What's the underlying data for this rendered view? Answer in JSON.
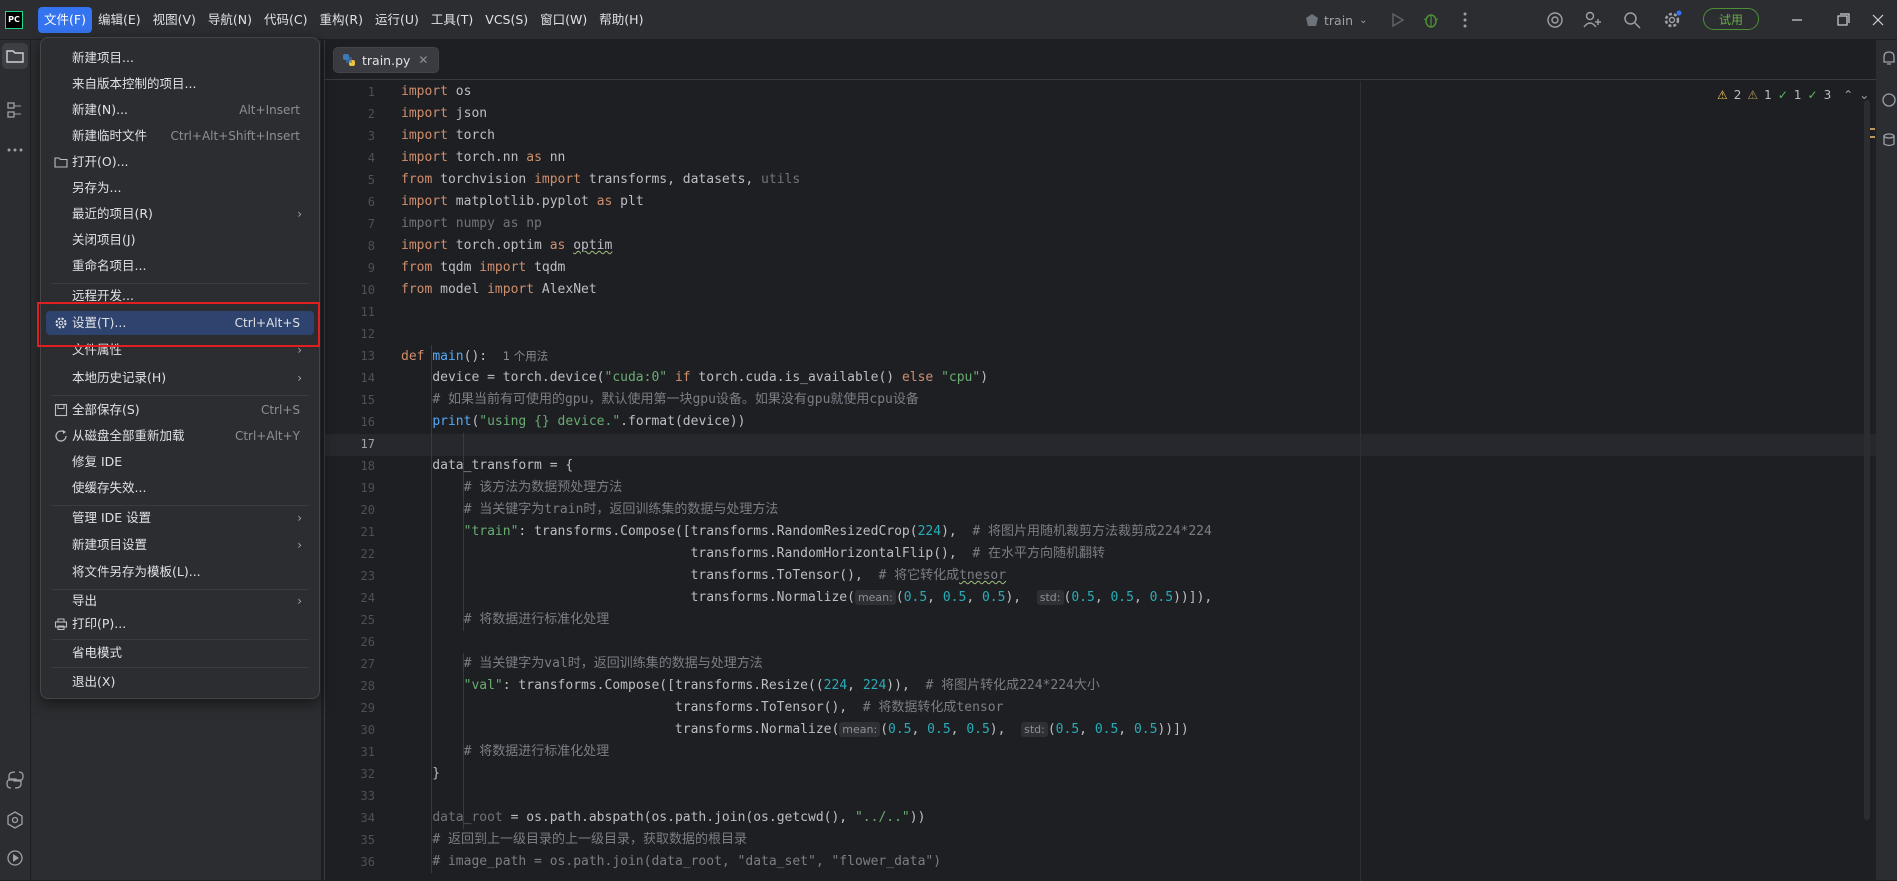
{
  "menubar": {
    "items": [
      "文件(F)",
      "编辑(E)",
      "视图(V)",
      "导航(N)",
      "代码(C)",
      "重构(R)",
      "运行(U)",
      "工具(T)",
      "VCS(S)",
      "窗口(W)",
      "帮助(H)"
    ]
  },
  "toolbar": {
    "run_config": "train",
    "trial_label": "试用"
  },
  "editor": {
    "tab_label": "train.py",
    "inspections": {
      "warnings": "2",
      "weak_warnings": "1",
      "typos": "1",
      "ok": "3"
    },
    "usage_hint": "1 个用法",
    "param_hints": {
      "mean": "mean:",
      "std": "std:"
    },
    "line_numbers": [
      "1",
      "2",
      "3",
      "4",
      "5",
      "6",
      "7",
      "8",
      "9",
      "10",
      "11",
      "12",
      "13",
      "14",
      "15",
      "16",
      "17",
      "18",
      "19",
      "20",
      "21",
      "22",
      "23",
      "24",
      "25",
      "26",
      "27",
      "28",
      "29",
      "30",
      "31",
      "32",
      "33",
      "34",
      "35",
      "36"
    ],
    "code": {
      "c14": "# 如果当前有可使用的gpu，默认使用第一块gpu设备。如果没有gpu就使用cpu设备",
      "c19": "# 该方法为数据预处理方法",
      "c20": "# 当关键字为train时，返回训练集的数据与处理方法",
      "c21": "# 将图片用随机裁剪方法裁剪成224*224",
      "c22": "# 在水平方向随机翻转",
      "c23a": "# 将它转化成",
      "c23b": "tnesor",
      "c25": "# 将数据进行标准化处理",
      "c27": "# 当关键字为val时，返回训练集的数据与处理方法",
      "c28": "# 将图片转化成224*224大小",
      "c29": "# 将数据转化成tensor",
      "c31": "# 将数据进行标准化处理",
      "c35": "# 返回到上一级目录的上一级目录，获取数据的根目录",
      "c36": "# image_path = os.path.join(data_root, \"data_set\", \"flower_data\")"
    }
  },
  "file_menu": {
    "items": [
      {
        "label": "新建项目...",
        "shortcut": ""
      },
      {
        "label": "来自版本控制的项目...",
        "shortcut": ""
      },
      {
        "label": "新建(N)...",
        "shortcut": "Alt+Insert"
      },
      {
        "label": "新建临时文件",
        "shortcut": "Ctrl+Alt+Shift+Insert"
      },
      {
        "label": "打开(O)...",
        "shortcut": ""
      },
      {
        "label": "另存为...",
        "shortcut": ""
      },
      {
        "label": "最近的项目(R)",
        "shortcut": ""
      },
      {
        "label": "关闭项目(J)",
        "shortcut": ""
      },
      {
        "label": "重命名项目...",
        "shortcut": ""
      },
      {
        "label": "远程开发...",
        "shortcut": ""
      },
      {
        "label": "设置(T)...",
        "shortcut": "Ctrl+Alt+S"
      },
      {
        "label": "文件属性",
        "shortcut": ""
      },
      {
        "label": "本地历史记录(H)",
        "shortcut": ""
      },
      {
        "label": "全部保存(S)",
        "shortcut": "Ctrl+S"
      },
      {
        "label": "从磁盘全部重新加载",
        "shortcut": "Ctrl+Alt+Y"
      },
      {
        "label": "修复 IDE",
        "shortcut": ""
      },
      {
        "label": "使缓存失效...",
        "shortcut": ""
      },
      {
        "label": "管理 IDE 设置",
        "shortcut": ""
      },
      {
        "label": "新建项目设置",
        "shortcut": ""
      },
      {
        "label": "将文件另存为模板(L)...",
        "shortcut": ""
      },
      {
        "label": "导出",
        "shortcut": ""
      },
      {
        "label": "打印(P)...",
        "shortcut": ""
      },
      {
        "label": "省电模式",
        "shortcut": ""
      },
      {
        "label": "退出(X)",
        "shortcut": ""
      }
    ]
  },
  "colors": {
    "accent": "#3574f0",
    "selection": "#2e436e",
    "highlight_border": "#e02020"
  }
}
